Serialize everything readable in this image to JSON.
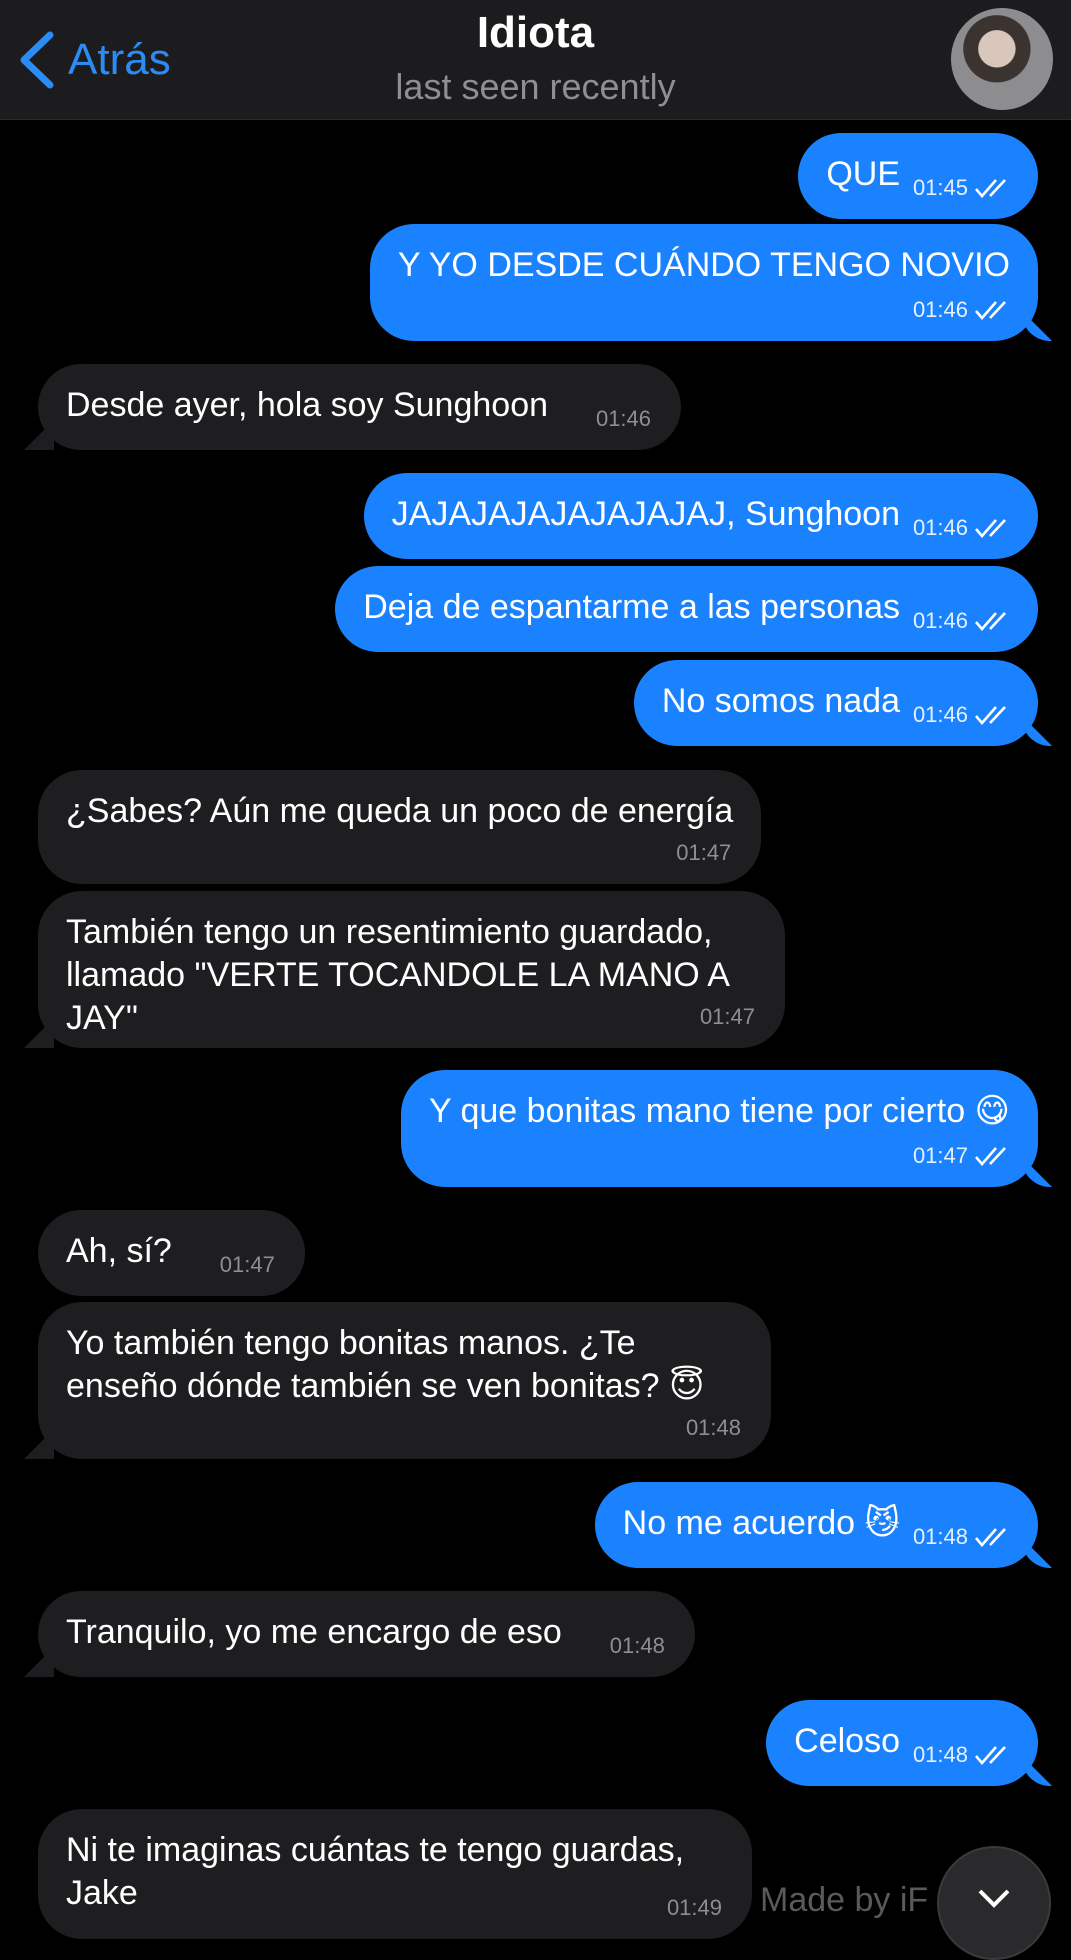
{
  "header": {
    "back_label": "Atrás",
    "title": "Idiota",
    "status": "last seen recently",
    "avatar_icon": "contact-avatar"
  },
  "messages": [
    {
      "dir": "out",
      "text": "QUE",
      "time": "01:45",
      "read": true
    },
    {
      "dir": "out",
      "text": "Y YO DESDE CUÁNDO TENGO NOVIO",
      "time": "01:46",
      "read": true
    },
    {
      "dir": "in",
      "text": "Desde ayer, hola soy Sunghoon",
      "time": "01:46"
    },
    {
      "dir": "out",
      "text": "JAJAJAJAJAJAJAJAJ, Sunghoon",
      "time": "01:46",
      "read": true
    },
    {
      "dir": "out",
      "text": "Deja de espantarme a las personas",
      "time": "01:46",
      "read": true
    },
    {
      "dir": "out",
      "text": "No somos nada",
      "time": "01:46",
      "read": true
    },
    {
      "dir": "in",
      "text": "¿Sabes? Aún me queda un poco de energía",
      "time": "01:47"
    },
    {
      "dir": "in",
      "text": "También tengo un resentimiento guardado, llamado \"VERTE TOCANDOLE LA MANO A JAY\"",
      "time": "01:47"
    },
    {
      "dir": "out",
      "text": "Y que bonitas mano tiene por cierto 😋",
      "time": "01:47",
      "read": true
    },
    {
      "dir": "in",
      "text": "Ah, sí?",
      "time": "01:47"
    },
    {
      "dir": "in",
      "text": "Yo también tengo bonitas manos. ¿Te enseño dónde también se ven bonitas? 😇",
      "time": "01:48"
    },
    {
      "dir": "out",
      "text": "No me acuerdo 😼",
      "time": "01:48",
      "read": true
    },
    {
      "dir": "in",
      "text": "Tranquilo, yo me encargo de eso",
      "time": "01:48"
    },
    {
      "dir": "out",
      "text": "Celoso",
      "time": "01:48",
      "read": true
    },
    {
      "dir": "in",
      "text": "Ni te imaginas cuántas te tengo guardas, Jake",
      "time": "01:49"
    }
  ],
  "watermark": "Made by iF",
  "colors": {
    "accent": "#2c8cf5",
    "outgoing": "#1a82ff",
    "incoming": "#1e1e20",
    "background": "#000000"
  }
}
